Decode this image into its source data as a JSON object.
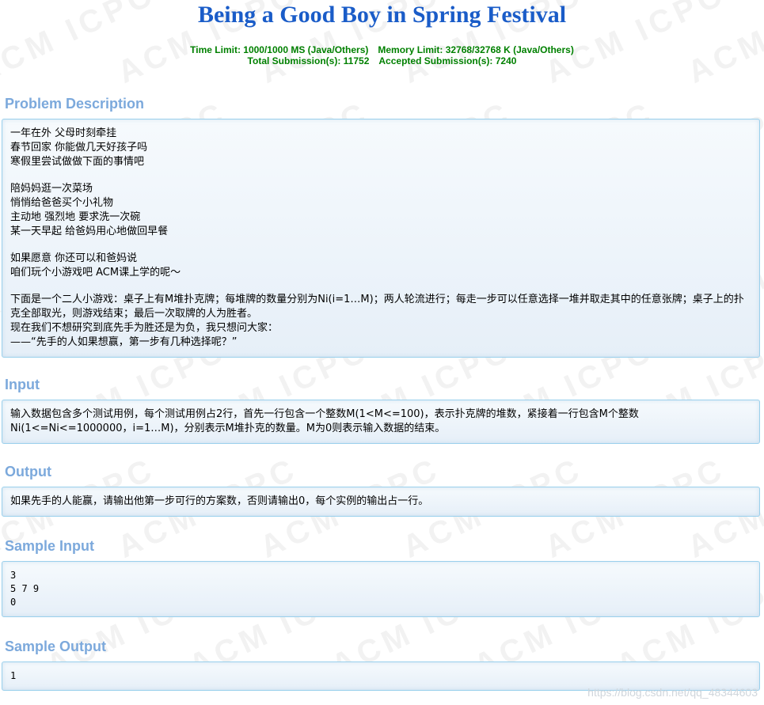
{
  "title": "Being a Good Boy in Spring Festival",
  "meta": {
    "time_limit": "Time Limit: 1000/1000 MS (Java/Others)",
    "memory_limit": "Memory Limit: 32768/32768 K (Java/Others)",
    "total_submissions": "Total Submission(s): 11752",
    "accepted_submissions": "Accepted Submission(s): 7240"
  },
  "sections": {
    "description": {
      "heading": "Problem Description",
      "paragraphs": [
        [
          "一年在外 父母时刻牵挂",
          "春节回家 你能做几天好孩子吗",
          "寒假里尝试做做下面的事情吧"
        ],
        [
          "陪妈妈逛一次菜场",
          "悄悄给爸爸买个小礼物",
          "主动地 强烈地 要求洗一次碗",
          "某一天早起 给爸妈用心地做回早餐"
        ],
        [
          "如果愿意 你还可以和爸妈说",
          "咱们玩个小游戏吧 ACM课上学的呢～"
        ],
        [
          "下面是一个二人小游戏：桌子上有M堆扑克牌；每堆牌的数量分别为Ni(i=1…M)；两人轮流进行；每走一步可以任意选择一堆并取走其中的任意张牌；桌子上的扑克全部取光，则游戏结束；最后一次取牌的人为胜者。",
          "现在我们不想研究到底先手为胜还是为负，我只想问大家：",
          "——“先手的人如果想赢，第一步有几种选择呢？”"
        ]
      ]
    },
    "input": {
      "heading": "Input",
      "text": "输入数据包含多个测试用例，每个测试用例占2行，首先一行包含一个整数M(1<M<=100)，表示扑克牌的堆数，紧接着一行包含M个整数Ni(1<=Ni<=1000000，i=1…M)，分别表示M堆扑克的数量。M为0则表示输入数据的结束。"
    },
    "output": {
      "heading": "Output",
      "text": "如果先手的人能赢，请输出他第一步可行的方案数，否则请输出0，每个实例的输出占一行。"
    },
    "sample_input": {
      "heading": "Sample Input",
      "lines": [
        "3",
        "5 7 9",
        "0"
      ]
    },
    "sample_output": {
      "heading": "Sample Output",
      "lines": [
        "1"
      ]
    }
  },
  "watermark_text": "ACM ICPC",
  "csdn_watermark": "https://blog.csdn.net/qq_48344603"
}
